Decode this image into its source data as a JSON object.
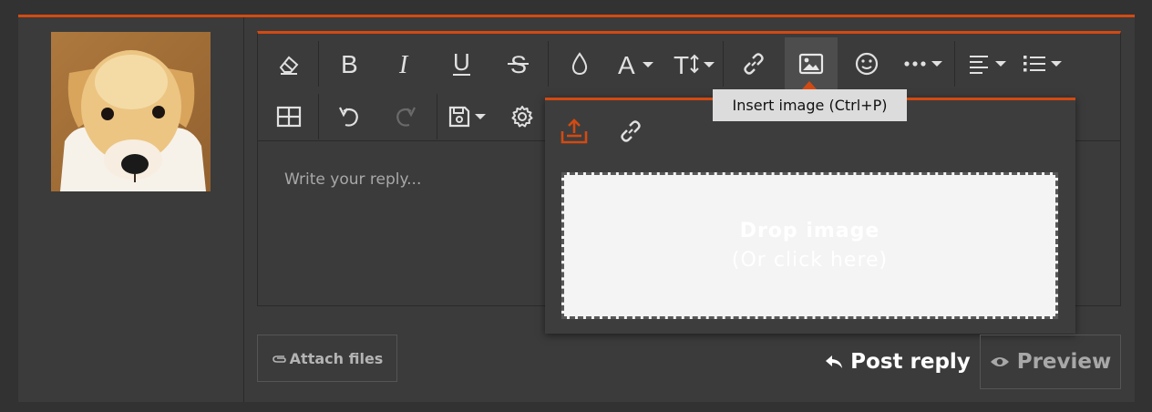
{
  "colors": {
    "accent": "#d24a12",
    "background": "#3b3b3b",
    "tooltip_bg": "#dcdcdc",
    "dropzone_bg": "#f4f4f4"
  },
  "user": {
    "avatar": "golden-retriever-puppy-avatar"
  },
  "toolbar": {
    "row1": [
      "eraser-icon",
      "bold-icon",
      "italic-icon",
      "underline-icon",
      "strikethrough-icon",
      "color-drop-icon",
      "font-family-icon",
      "font-size-icon",
      "link-icon",
      "image-icon",
      "smiley-icon",
      "more-icon",
      "align-icon",
      "list-icon"
    ],
    "row2": [
      "table-icon",
      "undo-icon",
      "redo-icon",
      "save-draft-icon",
      "settings-icon"
    ]
  },
  "editor": {
    "placeholder": "Write your reply..."
  },
  "tooltip": {
    "text": "Insert image (Ctrl+P)"
  },
  "image_popup": {
    "tabs": [
      "upload-icon",
      "url-link-icon"
    ],
    "dropzone_line1": "Drop image",
    "dropzone_line2": "(Or click here)"
  },
  "actions": {
    "attach_label": "Attach files",
    "post_label": "Post reply",
    "preview_label": "Preview"
  }
}
